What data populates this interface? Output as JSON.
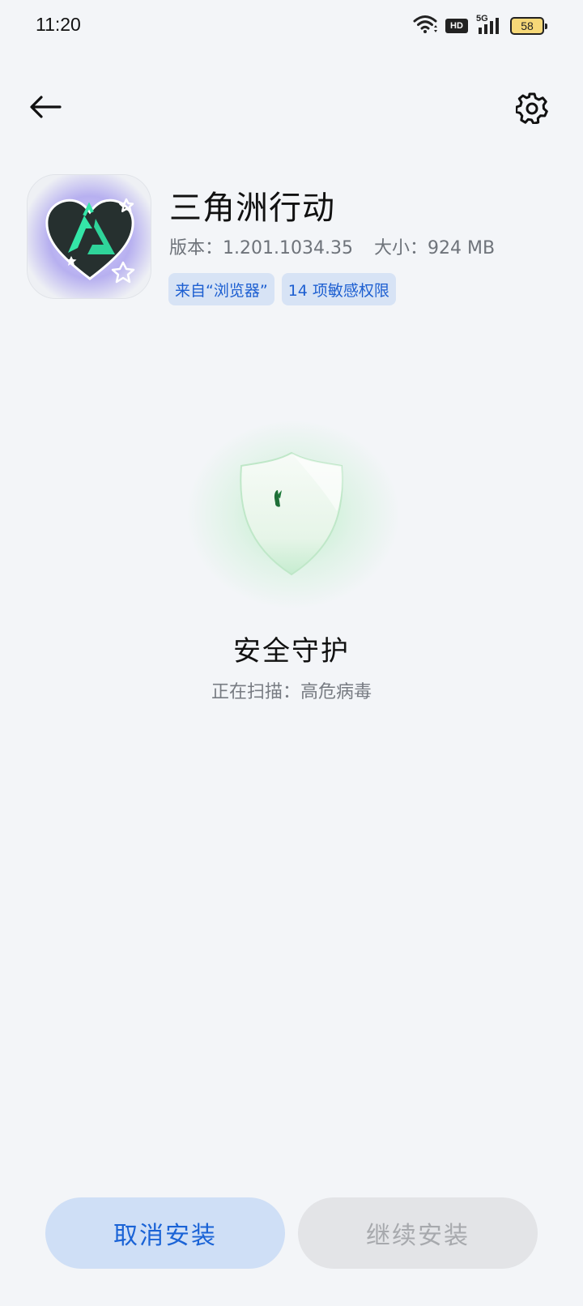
{
  "status_bar": {
    "time": "11:20",
    "network_label": "HD",
    "signal_label": "5G",
    "battery": "58",
    "icons": [
      "wifi-icon",
      "hd-voice-icon",
      "5g-signal-icon",
      "battery-icon"
    ]
  },
  "nav": {
    "back_icon": "arrow-left-icon",
    "settings_icon": "gear-icon"
  },
  "app": {
    "name": "三角洲行动",
    "version_label": "版本：",
    "version": "1.201.1034.35",
    "size_label": "大小：",
    "size": "924 MB",
    "tags": [
      "来自“浏览器”",
      "14 项敏感权限"
    ],
    "icon_name": "game-app-icon"
  },
  "scan": {
    "title": "安全守护",
    "subtitle": "正在扫描：高危病毒",
    "shield_icon": "shield-icon"
  },
  "actions": {
    "cancel": "取消安装",
    "continue": "继续安装"
  },
  "colors": {
    "background": "#f3f5f8",
    "accent": "#1a63d6",
    "tag_bg": "#d7e3f5",
    "shield_glow": "#aeebb9"
  }
}
